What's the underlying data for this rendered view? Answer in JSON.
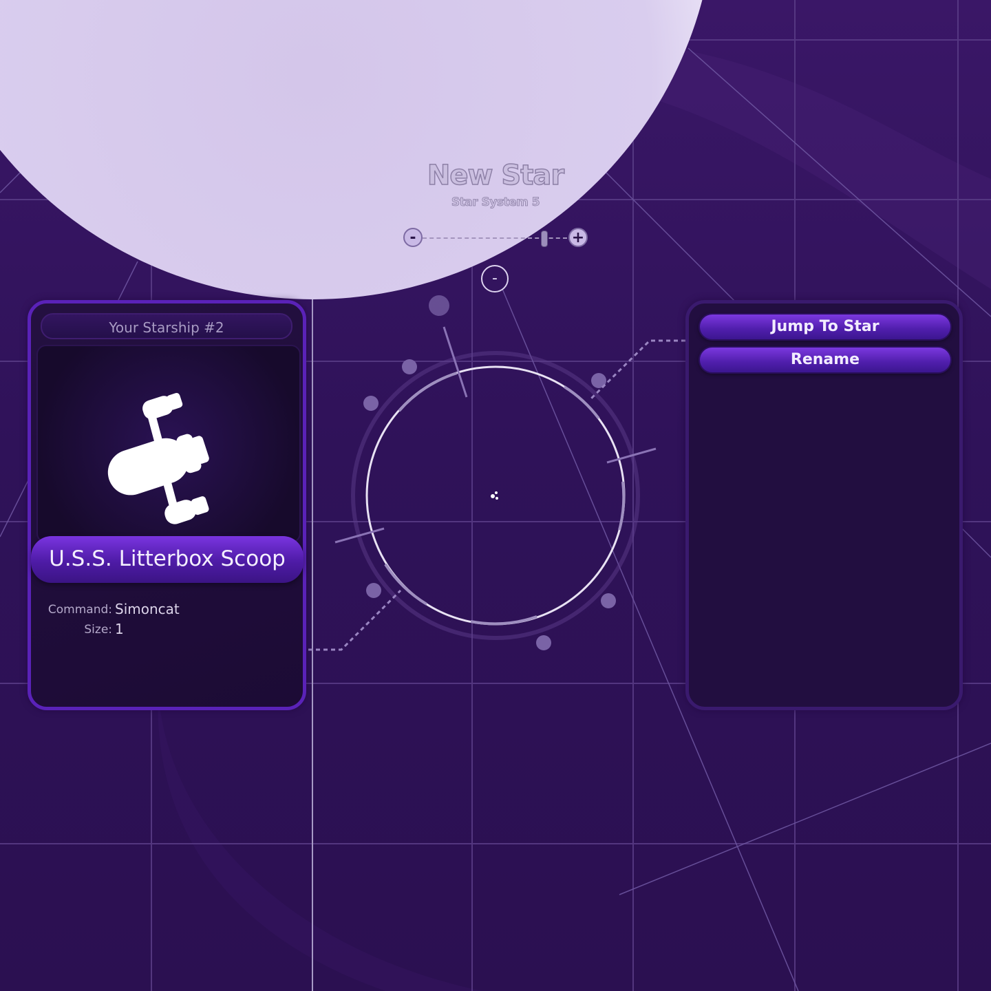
{
  "star": {
    "name": "New Star",
    "system": "Star System 5"
  },
  "zoom": {
    "minus_label": "-",
    "plus_label": "+",
    "level": 0.88,
    "collapse_label": "-"
  },
  "ship_panel": {
    "header": "Your Starship #2",
    "ship_name": "U.S.S. Litterbox Scoop",
    "ship_icon": "starship-icon",
    "command_label": "Command:",
    "command_value": "Simoncat",
    "size_label": "Size:",
    "size_value": "1"
  },
  "actions_panel": {
    "jump_label": "Jump To Star",
    "rename_label": "Rename"
  },
  "colors": {
    "background": "#2e1155",
    "star": "#e4dcf3",
    "panel_border": "#5a22b8",
    "button": "#6a2ad0"
  }
}
